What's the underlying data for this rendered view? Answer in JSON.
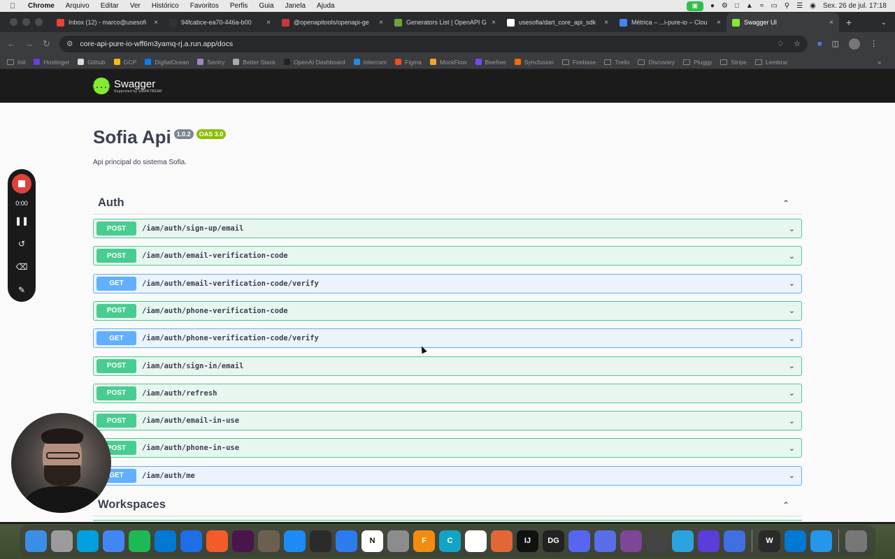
{
  "menubar": {
    "app": "Chrome",
    "items": [
      "Arquivo",
      "Editar",
      "Ver",
      "Histórico",
      "Favoritos",
      "Perfis",
      "Guia",
      "Janela",
      "Ajuda"
    ],
    "datetime": "Sex. 26 de jul.  17:18"
  },
  "tabs": [
    {
      "label": "Inbox (12) - marco@usesofi",
      "color": "#ea4335",
      "active": false
    },
    {
      "label": "94fcabce-ea70-446a-b00",
      "color": "#333333",
      "active": false
    },
    {
      "label": "@openapitools/openapi-ge",
      "color": "#cb3837",
      "active": false
    },
    {
      "label": "Generators List | OpenAPI G",
      "color": "#6ba539",
      "active": false
    },
    {
      "label": "usesofia/dart_core_api_sdk",
      "color": "#ffffff",
      "active": false
    },
    {
      "label": "Métrica – ...i-pure-io – Clou",
      "color": "#4285f4",
      "active": false
    },
    {
      "label": "Swagger UI",
      "color": "#85ea2d",
      "active": true
    }
  ],
  "omnibox": {
    "url": "core-api-pure-io-wff6m3yamq-rj.a.run.app/docs"
  },
  "bookmarks": [
    {
      "label": "Init",
      "type": "folder"
    },
    {
      "label": "Hostinger",
      "type": "site",
      "color": "#673de6"
    },
    {
      "label": "Github",
      "type": "site",
      "color": "#dddddd"
    },
    {
      "label": "GCP",
      "type": "site",
      "color": "#fbbc05"
    },
    {
      "label": "DigitalOcean",
      "type": "site",
      "color": "#0080ff"
    },
    {
      "label": "Sentry",
      "type": "site",
      "color": "#9e86c8"
    },
    {
      "label": "Better Stack",
      "type": "site",
      "color": "#aaaaaa"
    },
    {
      "label": "OpenAI Dashboard",
      "type": "site",
      "color": "#222222"
    },
    {
      "label": "Intercom",
      "type": "site",
      "color": "#1f8ded"
    },
    {
      "label": "Figma",
      "type": "site",
      "color": "#f24e1e"
    },
    {
      "label": "MockFlow",
      "type": "site",
      "color": "#f6a623"
    },
    {
      "label": "Beefree",
      "type": "site",
      "color": "#7747ff"
    },
    {
      "label": "Syncfusion",
      "type": "site",
      "color": "#ff6b00"
    },
    {
      "label": "Firebase",
      "type": "folder"
    },
    {
      "label": "Trello",
      "type": "folder"
    },
    {
      "label": "Discovery",
      "type": "folder"
    },
    {
      "label": "Pluggy",
      "type": "folder"
    },
    {
      "label": "Stripe",
      "type": "folder"
    },
    {
      "label": "Lembrar",
      "type": "folder"
    }
  ],
  "swagger": {
    "logo_badge": "{...}",
    "logo_name": "Swagger",
    "logo_sub": "Supported by SMARTBEAR",
    "title": "Sofia Api",
    "version": "1.0.2",
    "oas": "OAS 3.0",
    "description": "Api principal do sistema Sofia."
  },
  "sections": [
    {
      "name": "Auth",
      "operations": [
        {
          "method": "POST",
          "path": "/iam/auth/sign-up/email"
        },
        {
          "method": "POST",
          "path": "/iam/auth/email-verification-code"
        },
        {
          "method": "GET",
          "path": "/iam/auth/email-verification-code/verify"
        },
        {
          "method": "POST",
          "path": "/iam/auth/phone-verification-code"
        },
        {
          "method": "GET",
          "path": "/iam/auth/phone-verification-code/verify"
        },
        {
          "method": "POST",
          "path": "/iam/auth/sign-in/email"
        },
        {
          "method": "POST",
          "path": "/iam/auth/refresh"
        },
        {
          "method": "POST",
          "path": "/iam/auth/email-in-use"
        },
        {
          "method": "POST",
          "path": "/iam/auth/phone-in-use"
        },
        {
          "method": "GET",
          "path": "/iam/auth/me"
        }
      ]
    },
    {
      "name": "Workspaces",
      "operations": []
    }
  ],
  "recorder": {
    "time": "0:00"
  },
  "dock": [
    {
      "name": "finder",
      "color": "#3a8ee6",
      "glyph": ""
    },
    {
      "name": "launchpad",
      "color": "#9b9b9b",
      "glyph": ""
    },
    {
      "name": "files",
      "color": "#00a0e0",
      "glyph": ""
    },
    {
      "name": "chrome",
      "color": "#4285f4",
      "glyph": ""
    },
    {
      "name": "spotify",
      "color": "#1db954",
      "glyph": ""
    },
    {
      "name": "vscode",
      "color": "#0078d4",
      "glyph": ""
    },
    {
      "name": "xcode-instruments",
      "color": "#1c6fe6",
      "glyph": ""
    },
    {
      "name": "pencil",
      "color": "#f25c28",
      "glyph": ""
    },
    {
      "name": "slack",
      "color": "#4a154b",
      "glyph": ""
    },
    {
      "name": "gimp",
      "color": "#6b6050",
      "glyph": ""
    },
    {
      "name": "app-store",
      "color": "#1b8bf5",
      "glyph": ""
    },
    {
      "name": "activity-monitor",
      "color": "#2b2b2b",
      "glyph": ""
    },
    {
      "name": "xcode",
      "color": "#2d7bf0",
      "glyph": ""
    },
    {
      "name": "notion",
      "color": "#ffffff",
      "glyph": "N"
    },
    {
      "name": "system-settings",
      "color": "#8c8c8c",
      "glyph": ""
    },
    {
      "name": "fusion",
      "color": "#f28c0f",
      "glyph": "F"
    },
    {
      "name": "codeium",
      "color": "#12a4c4",
      "glyph": "C"
    },
    {
      "name": "mongodb",
      "color": "#ffffff",
      "glyph": ""
    },
    {
      "name": "matlab",
      "color": "#e16737",
      "glyph": ""
    },
    {
      "name": "intellij",
      "color": "#111111",
      "glyph": "IJ"
    },
    {
      "name": "datagrip",
      "color": "#222222",
      "glyph": "DG"
    },
    {
      "name": "discord",
      "color": "#5865f2",
      "glyph": ""
    },
    {
      "name": "settings-gear",
      "color": "#5a6de8",
      "glyph": ""
    },
    {
      "name": "tor",
      "color": "#7d4698",
      "glyph": ""
    },
    {
      "name": "unity",
      "color": "#444444",
      "glyph": ""
    },
    {
      "name": "telegram",
      "color": "#2aa3df",
      "glyph": ""
    },
    {
      "name": "rewind",
      "color": "#5b3ed9",
      "glyph": ""
    },
    {
      "name": "figma-like",
      "color": "#3f6fe0",
      "glyph": ""
    },
    {
      "name": "console",
      "color": "#2a2a2a",
      "glyph": "W"
    },
    {
      "name": "vscode-2",
      "color": "#0078d4",
      "glyph": ""
    },
    {
      "name": "docker",
      "color": "#2496ed",
      "glyph": ""
    },
    {
      "name": "trash",
      "color": "#777777",
      "glyph": ""
    }
  ]
}
